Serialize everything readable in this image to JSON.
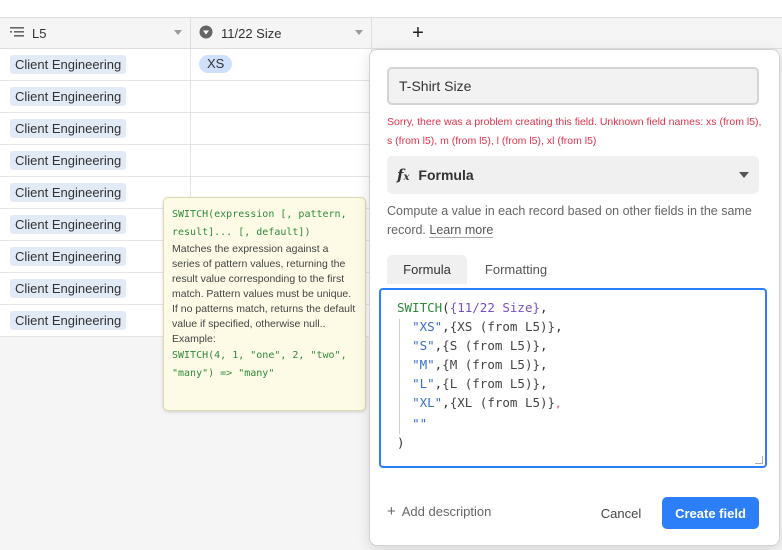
{
  "header": {
    "col1_label": "L5",
    "col2_label": "11/22 Size",
    "add_column_label": "+"
  },
  "rows": [
    {
      "team": "Client Engineering",
      "size": "XS"
    },
    {
      "team": "Client Engineering",
      "size": ""
    },
    {
      "team": "Client Engineering",
      "size": ""
    },
    {
      "team": "Client Engineering",
      "size": ""
    },
    {
      "team": "Client Engineering",
      "size": ""
    },
    {
      "team": "Client Engineering",
      "size": ""
    },
    {
      "team": "Client Engineering",
      "size": ""
    },
    {
      "team": "Client Engineering",
      "size": ""
    },
    {
      "team": "Client Engineering",
      "size": ""
    }
  ],
  "tooltip": {
    "signature": "SWITCH(expression [, pattern, result]... [, default])",
    "description": "Matches the expression against a series of pattern values, returning the result value corresponding to the first match. Pattern values must be unique. If no patterns match, returns the default value if specified, otherwise null.. Example:",
    "example": "SWITCH(4, 1, \"one\", 2, \"two\", \"many\") => \"many\""
  },
  "panel": {
    "field_name": "T-Shirt Size",
    "error": "Sorry, there was a problem creating this field. Unknown field names: xs (from l5), s (from l5), m (from l5), l (from l5), xl (from l5)",
    "field_type": "Formula",
    "help_text": "Compute a value in each record based on other fields in the same record.",
    "learn_more": "Learn more",
    "tabs": [
      "Formula",
      "Formatting"
    ],
    "add_description": "Add description",
    "cancel_label": "Cancel",
    "create_label": "Create field"
  },
  "formula": {
    "fn": "SWITCH",
    "switch_ref": "{11/22 Size}",
    "lines": [
      {
        "pattern": "\"XS\"",
        "result": "{XS (from L5)}"
      },
      {
        "pattern": "\"S\"",
        "result": "{S (from L5)}"
      },
      {
        "pattern": "\"M\"",
        "result": "{M (from L5)}"
      },
      {
        "pattern": "\"L\"",
        "result": "{L (from L5)}"
      },
      {
        "pattern": "\"XL\"",
        "result": "{XL (from L5)}"
      }
    ],
    "default": "\"\""
  }
}
